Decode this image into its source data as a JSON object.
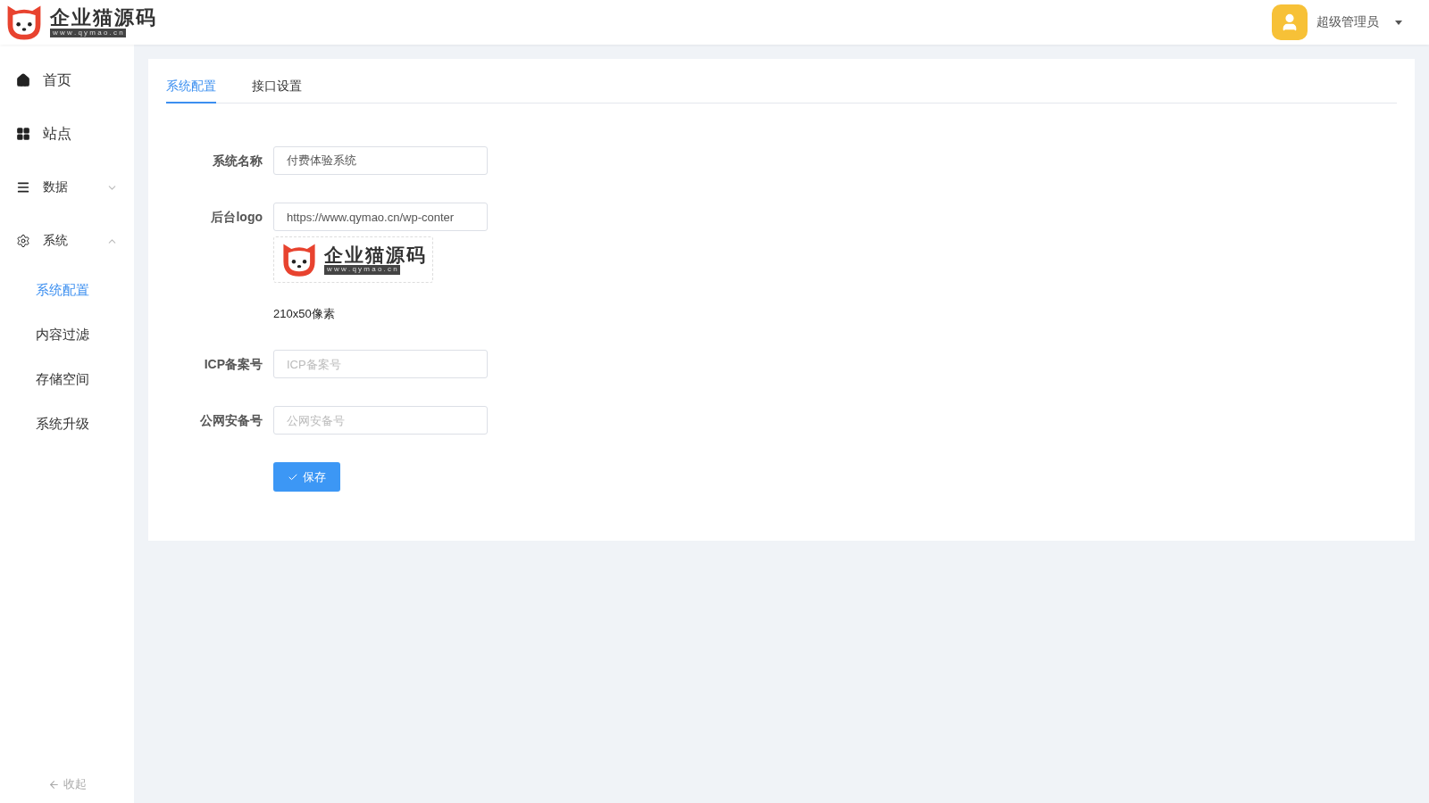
{
  "header": {
    "logo": {
      "name": "企业猫源码",
      "url": "w w w . q y m a o . c n"
    },
    "user": {
      "name": "超级管理员"
    }
  },
  "sidebar": {
    "items": [
      {
        "label": "首页",
        "kind": "link"
      },
      {
        "label": "站点",
        "kind": "link"
      },
      {
        "label": "数据",
        "kind": "group",
        "expanded": false
      },
      {
        "label": "系统",
        "kind": "group",
        "expanded": true,
        "children": [
          {
            "label": "系统配置",
            "selected": true
          },
          {
            "label": "内容过滤",
            "selected": false
          },
          {
            "label": "存储空间",
            "selected": false
          },
          {
            "label": "系统升级",
            "selected": false
          }
        ]
      }
    ],
    "collapse": "收起"
  },
  "tabs": [
    {
      "label": "系统配置",
      "selected": true
    },
    {
      "label": "接口设置",
      "selected": false
    }
  ],
  "form": {
    "fields": [
      {
        "label": "系统名称",
        "value": "付费体验系统"
      },
      {
        "label": "后台logo",
        "value": "https://www.qymao.cn/wp-conter",
        "preview": {
          "name": "企业猫源码",
          "url": "w w w . q y m a o . c n"
        },
        "hint": "210x50像素"
      },
      {
        "label": "ICP备案号",
        "placeholder": "ICP备案号"
      },
      {
        "label": "公网安备号",
        "placeholder": "公网安备号"
      }
    ],
    "submit": "保存"
  }
}
